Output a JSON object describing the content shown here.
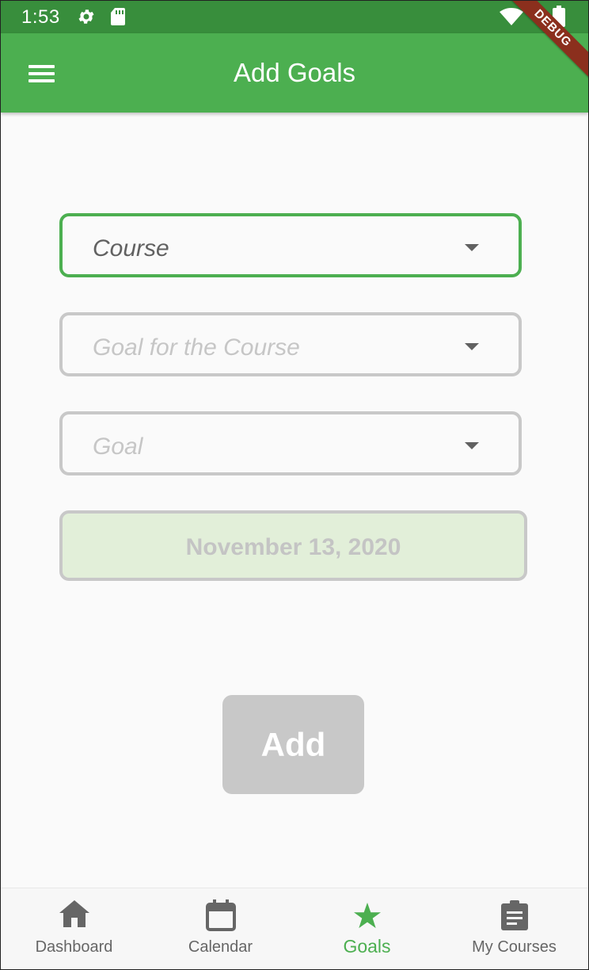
{
  "status_bar": {
    "time": "1:53",
    "icons": [
      "gear-icon",
      "sd-card-icon",
      "wifi-icon",
      "battery-icon"
    ],
    "color": "#388e3c"
  },
  "app_bar": {
    "title": "Add Goals",
    "menu_icon": "hamburger-menu-icon",
    "color": "#4caf50"
  },
  "debug_banner": "DEBUG",
  "form": {
    "course": {
      "placeholder": "Course",
      "active": true
    },
    "goal_for_course": {
      "placeholder": "Goal for the Course"
    },
    "goal": {
      "placeholder": "Goal"
    },
    "date": "November 13, 2020",
    "add_button": "Add"
  },
  "bottom_nav": {
    "items": [
      {
        "label": "Dashboard",
        "icon": "home-icon"
      },
      {
        "label": "Calendar",
        "icon": "calendar-icon"
      },
      {
        "label": "Goals",
        "icon": "star-icon",
        "active": true
      },
      {
        "label": "My Courses",
        "icon": "clipboard-icon"
      }
    ],
    "active_color": "#4caf50",
    "inactive_color": "#666666"
  }
}
